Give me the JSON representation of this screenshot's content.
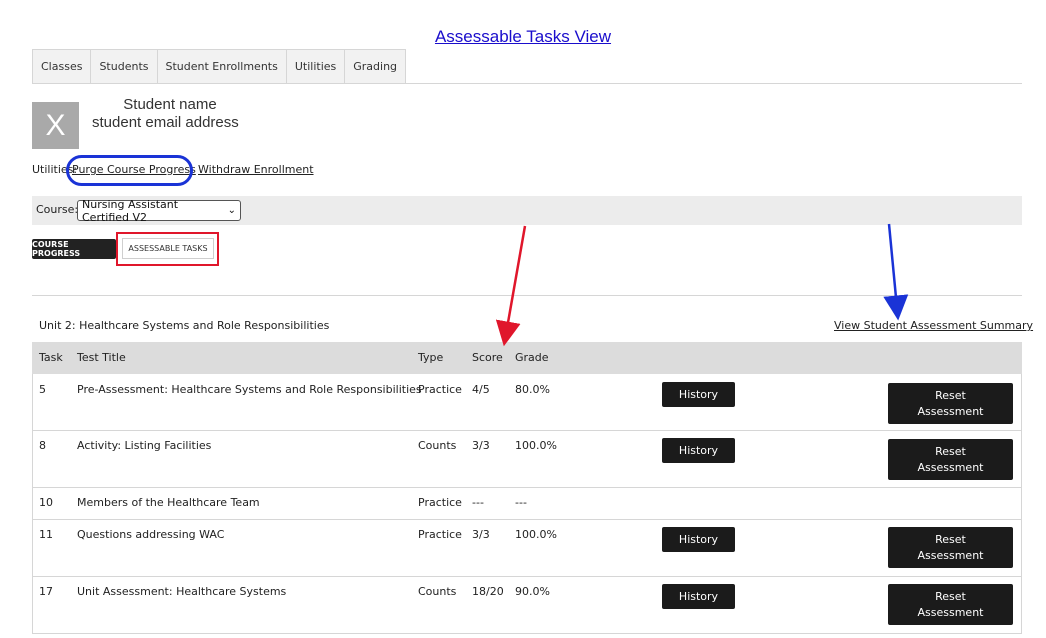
{
  "page_title": "Assessable Tasks View",
  "tabs": [
    "Classes",
    "Students",
    "Student Enrollments",
    "Utilities",
    "Grading"
  ],
  "student": {
    "avatar_letter": "X",
    "name": "Student name",
    "email": "student email address"
  },
  "utilities": {
    "label": "Utilities:",
    "purge": "Purge Course Progress",
    "withdraw": "Withdraw Enrollment"
  },
  "course": {
    "label": "Course:",
    "selected": "Nursing Assistant Certified V2"
  },
  "view_buttons": {
    "course_progress": "COURSE PROGRESS",
    "assessable_tasks": "ASSESSABLE TASKS"
  },
  "unit_title": "Unit 2: Healthcare Systems and Role Responsibilities",
  "summary_link": "View Student Assessment Summary",
  "table": {
    "headers": [
      "Task",
      "Test Title",
      "Type",
      "Score",
      "Grade"
    ],
    "rows": [
      {
        "task": "5",
        "title": "Pre-Assessment: Healthcare Systems and Role Responsibilities",
        "type": "Practice",
        "score": "4/5",
        "grade": "80.0%",
        "history": "History",
        "reset": [
          "Reset",
          "Assessment"
        ]
      },
      {
        "task": "8",
        "title": "Activity: Listing Facilities",
        "type": "Counts",
        "score": "3/3",
        "grade": "100.0%",
        "history": "History",
        "reset": [
          "Reset",
          "Assessment"
        ]
      },
      {
        "task": "10",
        "title": "Members of the Healthcare Team",
        "type": "Practice",
        "score": "---",
        "grade": "---"
      },
      {
        "task": "11",
        "title": "Questions addressing WAC",
        "type": "Practice",
        "score": "3/3",
        "grade": "100.0%",
        "history": "History",
        "reset": [
          "Reset",
          "Assessment"
        ]
      },
      {
        "task": "17",
        "title": "Unit Assessment: Healthcare Systems",
        "type": "Counts",
        "score": "18/20",
        "grade": "90.0%",
        "history": "History",
        "reset": [
          "Reset",
          "Assessment"
        ]
      }
    ]
  },
  "colors": {
    "annotation_red": "#e0162b",
    "annotation_blue": "#1a33d6",
    "title_link": "#1a0dcc"
  }
}
